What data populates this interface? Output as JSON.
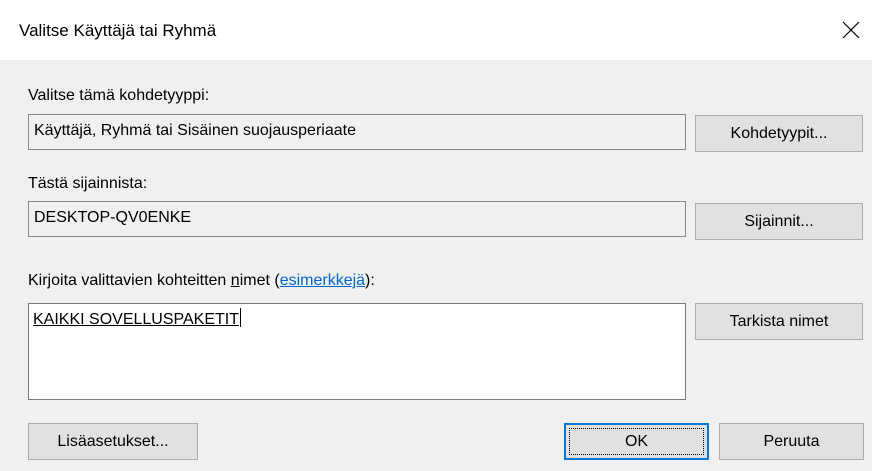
{
  "window": {
    "title": "Valitse Käyttäjä tai Ryhmä",
    "close_icon": "close-x-icon"
  },
  "object_type": {
    "label": "Valitse tämä kohdetyyppi:",
    "value": "Käyttäjä, Ryhmä tai Sisäinen suojausperiaate",
    "button_label": "Kohdetyypit..."
  },
  "location": {
    "label": "Tästä sijainnista:",
    "value": "DESKTOP-QV0ENKE",
    "button_label": "Sijainnit..."
  },
  "names": {
    "label_before": "Kirjoita valittavien kohteitten ",
    "label_mnemonic": "n",
    "label_middle": "imet (",
    "examples_link": "esimerkkejä",
    "label_after": "):",
    "entered_value": "KAIKKI SOVELLUSPAKETIT",
    "check_button_label": "Tarkista nimet"
  },
  "footer": {
    "advanced_label": "Lisäasetukset...",
    "ok_label": "OK",
    "cancel_label": "Peruuta"
  },
  "colors": {
    "title_bar": "#ffffff",
    "client_background": "#f0f0f0",
    "button_face": "#e1e1e1",
    "default_button_border": "#0078d7",
    "link": "#0066cc"
  }
}
